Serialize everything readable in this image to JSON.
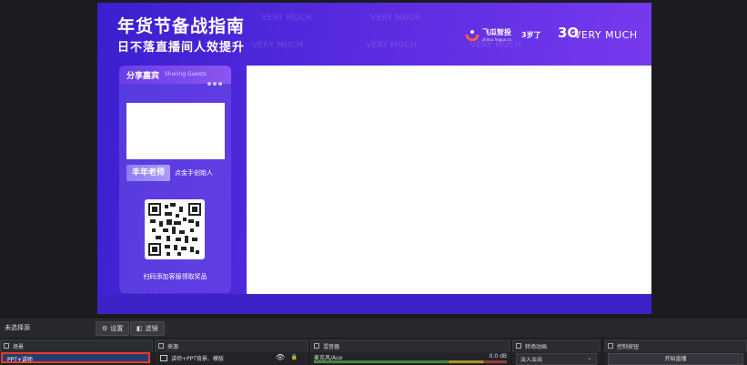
{
  "canvas": {
    "title": "年货节备战指南",
    "subtitle": "日不落直播间人效提升",
    "watermark": "VERY MUCH",
    "brand_feigua": {
      "name": "飞瓜智投",
      "url": "zhitou.feigua.cn",
      "years": "3岁了"
    },
    "brand_verymuch": {
      "mark": "3ʘ",
      "text": "VERY MUCH"
    },
    "guest_panel": {
      "title": "分享嘉宾",
      "subtitle": "Sharing Guests",
      "guest_name": "丰年老师",
      "guest_desc": "点金手创始人",
      "qr_caption": "扫码添加客服领取奖品"
    }
  },
  "status_bar": {
    "no_source": "未选择源",
    "settings_button": "设置",
    "filters_button": "滤镜"
  },
  "docks": {
    "scenes": {
      "title": "场景",
      "items": [
        "PPT+讲师"
      ]
    },
    "sources": {
      "title": "来源",
      "items": [
        "讲师+PPT背景、模版"
      ]
    },
    "mixer": {
      "title": "混音器",
      "channel": "麦克风/Aux",
      "level": "0.0 dB"
    },
    "transitions": {
      "title": "转场动画",
      "selected": "淡入淡出"
    },
    "controls": {
      "title": "控制按钮",
      "start_stream": "开始直播"
    }
  },
  "colors": {
    "accent_purple": "#5a2be0",
    "selected_scene": "#2a3a6f",
    "highlight_border": "#e53b2c"
  }
}
